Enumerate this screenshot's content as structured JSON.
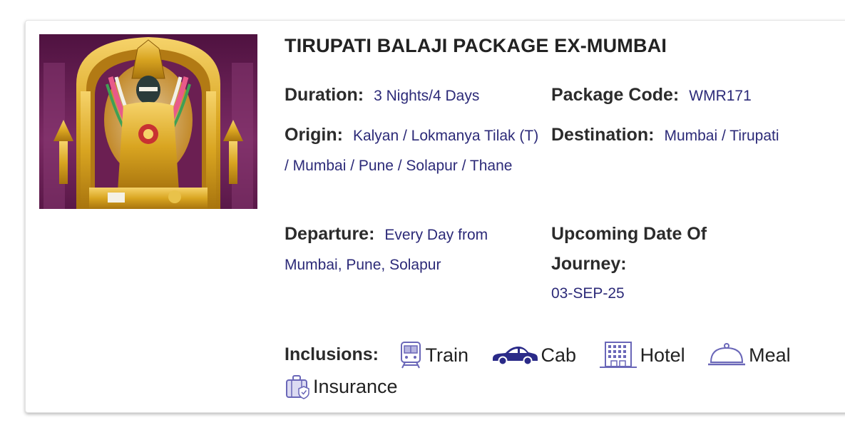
{
  "package": {
    "title": "TIRUPATI BALAJI PACKAGE EX-MUMBAI",
    "duration_label": "Duration:",
    "duration_value": "3 Nights/4 Days",
    "code_label": "Package Code:",
    "code_value": "WMR171",
    "origin_label": "Origin:",
    "origin_value": "Kalyan / Lokmanya Tilak (T) / Mumbai / Pune / Solapur / Thane",
    "destination_label": "Destination:",
    "destination_value": "Mumbai / Tirupati",
    "departure_label": "Departure:",
    "departure_value": "Every Day from Mumbai, Pune, Solapur",
    "upcoming_label": "Upcoming Date Of Journey:",
    "upcoming_value": "03-SEP-25"
  },
  "inclusions": {
    "label": "Inclusions:",
    "items": [
      {
        "icon": "train-icon",
        "label": "Train"
      },
      {
        "icon": "cab-icon",
        "label": "Cab"
      },
      {
        "icon": "hotel-icon",
        "label": "Hotel"
      },
      {
        "icon": "meal-icon",
        "label": "Meal"
      },
      {
        "icon": "insurance-icon",
        "label": "Insurance"
      }
    ]
  },
  "colors": {
    "value_text": "#2c2a78",
    "label_text": "#2b2b2b",
    "icon": "#6a67b8",
    "image_background": "#6b1f52",
    "image_gold": "#d9a521"
  }
}
